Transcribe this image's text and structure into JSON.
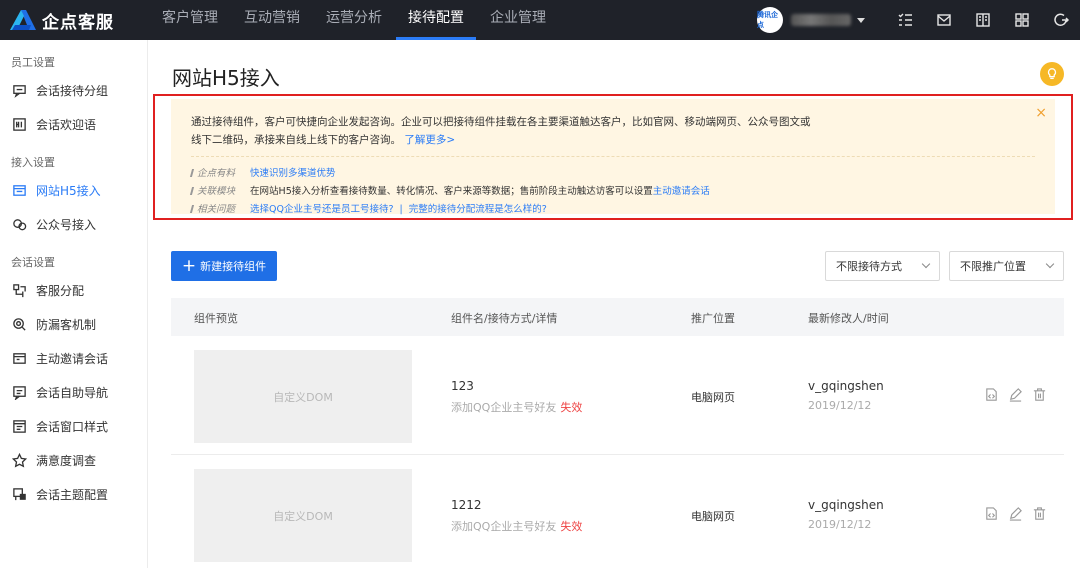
{
  "app": {
    "name": "企点客服"
  },
  "topnav": [
    {
      "label": "客户管理"
    },
    {
      "label": "互动营销"
    },
    {
      "label": "运营分析"
    },
    {
      "label": "接待配置",
      "active": true
    },
    {
      "label": "企业管理"
    }
  ],
  "user": {
    "avatar_text": "腾讯企点"
  },
  "sidebar": {
    "groups": [
      {
        "title": "员工设置",
        "items": [
          {
            "label": "会话接待分组",
            "icon": "chat-group-icon"
          },
          {
            "label": "会话欢迎语",
            "icon": "welcome-icon"
          }
        ]
      },
      {
        "title": "接入设置",
        "items": [
          {
            "label": "网站H5接入",
            "icon": "web-h5-icon",
            "active": true
          },
          {
            "label": "公众号接入",
            "icon": "official-account-icon"
          }
        ]
      },
      {
        "title": "会话设置",
        "items": [
          {
            "label": "客服分配",
            "icon": "distribute-icon"
          },
          {
            "label": "防漏客机制",
            "icon": "anti-loss-icon"
          },
          {
            "label": "主动邀请会话",
            "icon": "invite-icon"
          },
          {
            "label": "会话自助导航",
            "icon": "navigation-icon"
          },
          {
            "label": "会话窗口样式",
            "icon": "window-style-icon"
          },
          {
            "label": "满意度调查",
            "icon": "satisfaction-icon"
          },
          {
            "label": "会话主题配置",
            "icon": "theme-icon"
          }
        ]
      }
    ]
  },
  "page": {
    "title": "网站H5接入"
  },
  "notice": {
    "line1": "通过接待组件，客户可快捷向企业发起咨询。企业可以把接待组件挂载在各主要渠道触达客户，比如官网、移动端网页、公众号图文或",
    "line2": "线下二维码，承接来自线上线下的客户咨询。",
    "learn_more": "了解更多>",
    "close": "×",
    "row1": {
      "tag": "企点有料",
      "link": "快速识别多渠道优势"
    },
    "row2": {
      "tag": "关联模块",
      "text": "在网站H5接入分析查看接待数量、转化情况、客户来源等数据；售前阶段主动触达访客可以设置",
      "link": "主动邀请会话"
    },
    "row3": {
      "tag": "相关问题",
      "link1": "选择QQ企业主号还是员工号接待?",
      "sep": "|",
      "link2": "完整的接待分配流程是怎么样的?"
    }
  },
  "toolbar": {
    "new_button": "新建接待组件",
    "filter_method": "不限接待方式",
    "filter_position": "不限推广位置"
  },
  "table": {
    "headers": {
      "preview": "组件预览",
      "name": "组件名/接待方式/详情",
      "position": "推广位置",
      "modifier": "最新修改人/时间"
    },
    "rows": [
      {
        "preview": "自定义DOM",
        "name": "123",
        "method": "添加QQ企业主号好友",
        "status": "失效",
        "position": "电脑网页",
        "user": "v_gqingshen",
        "time": "2019/12/12"
      },
      {
        "preview": "自定义DOM",
        "name": "1212",
        "method": "添加QQ企业主号好友",
        "status": "失效",
        "position": "电脑网页",
        "user": "v_gqingshen",
        "time": "2019/12/12"
      }
    ]
  },
  "colors": {
    "topbar": "#1f2229",
    "accent": "#2b7cf6",
    "notice_bg": "#fff6e3",
    "highlight_border": "#e02020",
    "danger": "#e44444"
  }
}
